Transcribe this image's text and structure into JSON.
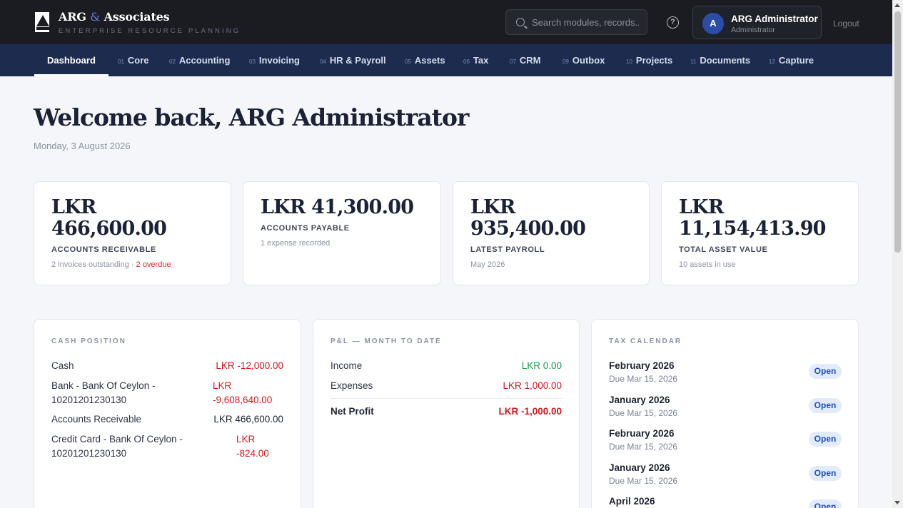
{
  "header": {
    "brand_part1": "ARG",
    "brand_amp": "&",
    "brand_part2": "Associates",
    "brand_subtitle": "ENTERPRISE RESOURCE PLANNING",
    "search_placeholder": "Search modules, records...",
    "help_glyph": "?",
    "user_initial": "A",
    "user_name": "ARG Administrator",
    "user_role": "Administrator",
    "logout_label": "Logout"
  },
  "nav": {
    "items": [
      {
        "num": "",
        "label": "Dashboard"
      },
      {
        "num": "01",
        "label": "Core"
      },
      {
        "num": "02",
        "label": "Accounting"
      },
      {
        "num": "03",
        "label": "Invoicing"
      },
      {
        "num": "04",
        "label": "HR & Payroll"
      },
      {
        "num": "05",
        "label": "Assets"
      },
      {
        "num": "06",
        "label": "Tax"
      },
      {
        "num": "07",
        "label": "CRM"
      },
      {
        "num": "09",
        "label": "Outbox"
      },
      {
        "num": "10",
        "label": "Projects"
      },
      {
        "num": "11",
        "label": "Documents"
      },
      {
        "num": "12",
        "label": "Capture"
      }
    ]
  },
  "page": {
    "welcome": "Welcome back, ARG Administrator",
    "date": "Monday, 3 August 2026"
  },
  "stats": [
    {
      "currency": "LKR",
      "amount": "466,600.00",
      "label": "ACCOUNTS RECEIVABLE",
      "sub": "2 invoices outstanding · ",
      "sub_warn": "2 overdue"
    },
    {
      "currency": "LKR",
      "amount": "41,300.00",
      "label": "ACCOUNTS PAYABLE",
      "sub": "1 expense recorded"
    },
    {
      "currency": "LKR",
      "amount": "935,400.00",
      "label": "LATEST PAYROLL",
      "sub": "May 2026"
    },
    {
      "currency": "LKR",
      "amount": "11,154,413.90",
      "label": "TOTAL ASSET VALUE",
      "sub": "10 assets in use"
    }
  ],
  "cash_position": {
    "title": "CASH POSITION",
    "rows": [
      {
        "label": "Cash",
        "value": "LKR -12,000.00"
      },
      {
        "label_line1": "Bank - Bank Of Ceylon -",
        "label_line2": "10201201230130",
        "value_line1": "LKR",
        "value_line2": "-9,608,640.00"
      },
      {
        "label": "Accounts Receivable",
        "value": "LKR 466,600.00"
      },
      {
        "label_line1": "Credit Card - Bank Of Ceylon -",
        "label_line2": "10201201230130",
        "value_line1": "LKR",
        "value_line2": "-824.00"
      }
    ],
    "colors": {
      "negative": "#d9161d",
      "positive": "#1f2434"
    }
  },
  "pnl": {
    "title": "P&L — MONTH TO DATE",
    "income_label": "Income",
    "income_value": "LKR 0.00",
    "expenses_label": "Expenses",
    "expenses_value": "LKR 1,000.00",
    "net_label": "Net Profit",
    "net_value": "LKR -1,000.00"
  },
  "tax_calendar": {
    "title": "TAX CALENDAR",
    "items": [
      {
        "period": "February 2026",
        "due": "Due Mar 15, 2026",
        "status": "Open"
      },
      {
        "period": "January 2026",
        "due": "Due Mar 15, 2026",
        "status": "Open"
      },
      {
        "period": "February 2026",
        "due": "Due Mar 15, 2026",
        "status": "Open"
      },
      {
        "period": "January 2026",
        "due": "Due Mar 15, 2026",
        "status": "Open"
      },
      {
        "period": "April 2026",
        "due": "",
        "status": "Open"
      }
    ]
  }
}
